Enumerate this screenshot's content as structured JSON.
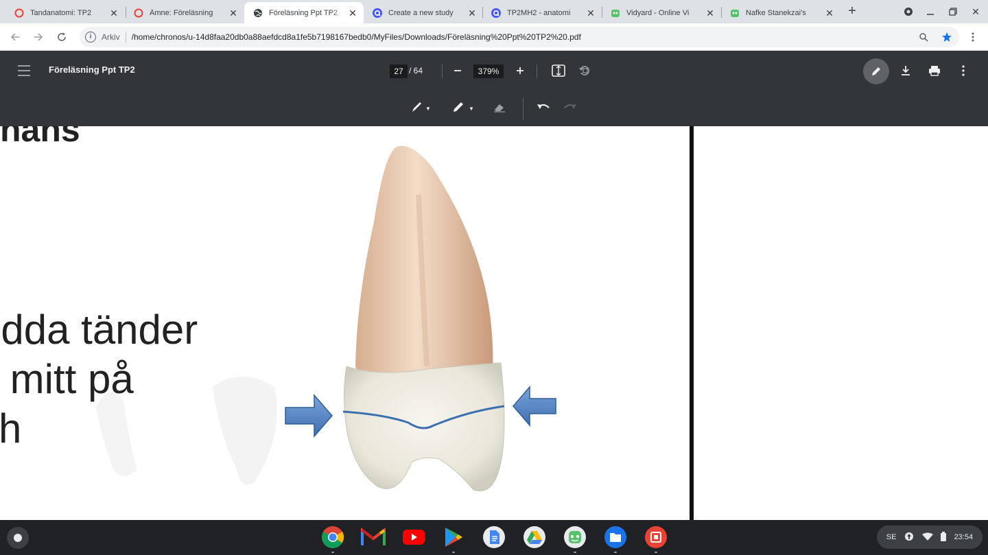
{
  "tabs": [
    {
      "title": "Tandanatomi: TP2",
      "favicon": "red-circle-icon",
      "active": false
    },
    {
      "title": "Ämne: Föreläsning",
      "favicon": "red-circle-icon",
      "active": false
    },
    {
      "title": "Föreläsning Ppt TP2",
      "favicon": "globe-icon",
      "active": true
    },
    {
      "title": "Create a new study",
      "favicon": "quizlet-icon",
      "active": false
    },
    {
      "title": "TP2MH2 - anatomi",
      "favicon": "quizlet-icon",
      "active": false
    },
    {
      "title": "Vidyard - Online Vi",
      "favicon": "vidyard-icon",
      "active": false
    },
    {
      "title": "Nafke Stanekzai's",
      "favicon": "vidyard-icon",
      "active": false
    }
  ],
  "address_bar": {
    "chip": "Arkiv",
    "url": "/home/chronos/u-14d8faa20db0a88aefdcd8a1fe5b7198167bedb0/MyFiles/Downloads/Föreläsning%20Ppt%20TP2%20.pdf"
  },
  "pdf": {
    "title": "Föreläsning Ppt TP2",
    "current_page": "27",
    "total_pages": "/ 64",
    "zoom": "379%"
  },
  "slide": {
    "heading": "hans",
    "lines": [
      "edda tänder",
      "s mitt på",
      "ch"
    ]
  },
  "shelf": {
    "apps": [
      "chrome-icon",
      "gmail-icon",
      "youtube-icon",
      "play-store-icon",
      "docs-icon",
      "drive-icon",
      "vidyard-icon",
      "files-icon",
      "screen-capture-icon"
    ],
    "locale": "SE",
    "time": "23:54"
  },
  "colors": {
    "tab_strip": "#dee1e6",
    "pdf_toolbar": "#323639",
    "shelf": "#202124",
    "arrow_blue": "#4a7fc1",
    "cej_line": "#3a6fb0"
  }
}
